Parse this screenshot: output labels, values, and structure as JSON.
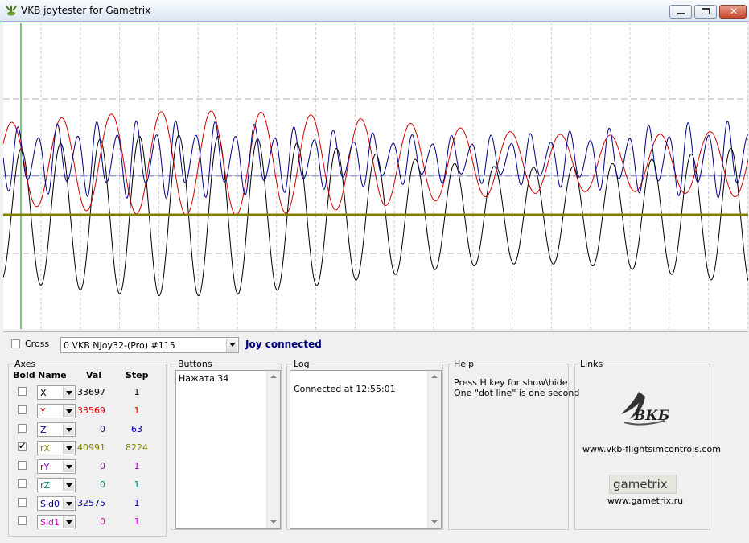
{
  "window": {
    "title": "VKB joytester for Gametrix"
  },
  "top": {
    "cross_label": "Cross",
    "device": "0 VKB NJoy32-(Pro)  #115",
    "status": "Joy connected"
  },
  "axes": {
    "group_label": "Axes",
    "headers": {
      "bold": "Bold",
      "name": "Name",
      "val": "Val",
      "step": "Step"
    },
    "rows": [
      {
        "name": "X",
        "val": "33697",
        "step": "1",
        "checked": false,
        "color": "#000000"
      },
      {
        "name": "Y",
        "val": "33569",
        "step": "1",
        "checked": false,
        "color": "#e00000"
      },
      {
        "name": "Z",
        "val": "0",
        "step": "63",
        "checked": false,
        "color": "#000099"
      },
      {
        "name": "rX",
        "val": "40991",
        "step": "8224",
        "checked": true,
        "color": "#808000"
      },
      {
        "name": "rY",
        "val": "0",
        "step": "1",
        "checked": false,
        "color": "#9000c0"
      },
      {
        "name": "rZ",
        "val": "0",
        "step": "1",
        "checked": false,
        "color": "#008080"
      },
      {
        "name": "Sld0",
        "val": "32575",
        "step": "1",
        "checked": false,
        "color": "#000099"
      },
      {
        "name": "Sld1",
        "val": "0",
        "step": "1",
        "checked": false,
        "color": "#d000d0"
      }
    ]
  },
  "buttons": {
    "group_label": "Buttons",
    "text": "Нажата 34"
  },
  "log": {
    "group_label": "Log",
    "text": "Connected at 12:55:01"
  },
  "help": {
    "group_label": "Help",
    "line1": "Press H key for show\\hide",
    "line2": "One \"dot line\" is one second"
  },
  "links": {
    "group_label": "Links",
    "vkb_logo": "ВКБ",
    "vkb_url": "www.vkb-flightsimcontrols.com",
    "gametrix_logo": "gametrix",
    "gametrix_url": "www.gametrix.ru"
  },
  "plot": {
    "colors": {
      "red": "#d00000",
      "blue": "#000080",
      "black": "#000000",
      "olive": "#808000",
      "green": "#008000"
    }
  }
}
